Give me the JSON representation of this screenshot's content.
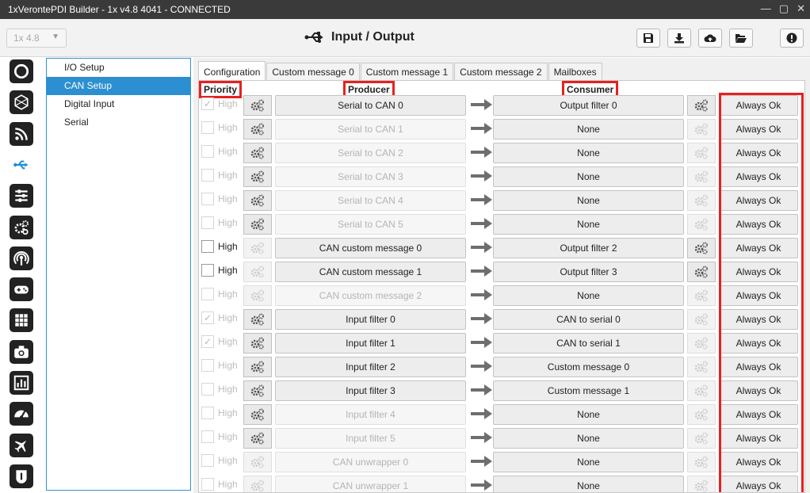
{
  "window": {
    "title": "1xVerontePDI Builder - 1x v4.8 4041 - CONNECTED",
    "controls": [
      "—",
      "▢",
      "✕"
    ]
  },
  "header": {
    "version": "1x 4.8",
    "page_title": "Input / Output",
    "buttons": [
      "save-icon",
      "download-icon",
      "cloud-upload-icon",
      "folder-open-icon",
      "info-icon"
    ]
  },
  "sidebar_icons": [
    "status-icon",
    "hex-icon",
    "rss-icon",
    "usb-icon",
    "sliders-icon",
    "gears-icon",
    "broadcast-icon",
    "gamepad-icon",
    "grid-icon",
    "camera-icon",
    "bar-chart-icon",
    "gauge-icon",
    "plane-icon",
    "shield-icon"
  ],
  "nav": {
    "items": [
      "I/O Setup",
      "CAN Setup",
      "Digital Input",
      "Serial"
    ],
    "selected": "CAN Setup"
  },
  "tabs": [
    "Configuration",
    "Custom message 0",
    "Custom message 1",
    "Custom message 2",
    "Mailboxes"
  ],
  "active_tab": "Configuration",
  "columns": {
    "priority": "Priority",
    "producer": "Producer",
    "consumer": "Consumer"
  },
  "rows": [
    {
      "checked": true,
      "priority_enabled": false,
      "high": "High",
      "prod_gear": true,
      "producer": "Serial to CAN 0",
      "producer_enabled": true,
      "consumer": "Output filter 0",
      "cons_gear": true,
      "status": "Always Ok"
    },
    {
      "checked": false,
      "priority_enabled": false,
      "high": "High",
      "prod_gear": true,
      "producer": "Serial to CAN 1",
      "producer_enabled": false,
      "consumer": "None",
      "cons_gear": false,
      "status": "Always Ok"
    },
    {
      "checked": false,
      "priority_enabled": false,
      "high": "High",
      "prod_gear": true,
      "producer": "Serial to CAN 2",
      "producer_enabled": false,
      "consumer": "None",
      "cons_gear": false,
      "status": "Always Ok"
    },
    {
      "checked": false,
      "priority_enabled": false,
      "high": "High",
      "prod_gear": true,
      "producer": "Serial to CAN 3",
      "producer_enabled": false,
      "consumer": "None",
      "cons_gear": false,
      "status": "Always Ok"
    },
    {
      "checked": false,
      "priority_enabled": false,
      "high": "High",
      "prod_gear": true,
      "producer": "Serial to CAN 4",
      "producer_enabled": false,
      "consumer": "None",
      "cons_gear": false,
      "status": "Always Ok"
    },
    {
      "checked": false,
      "priority_enabled": false,
      "high": "High",
      "prod_gear": true,
      "producer": "Serial to CAN 5",
      "producer_enabled": false,
      "consumer": "None",
      "cons_gear": false,
      "status": "Always Ok"
    },
    {
      "checked": false,
      "priority_enabled": true,
      "high": "High",
      "prod_gear": false,
      "producer": "CAN custom message 0",
      "producer_enabled": true,
      "consumer": "Output filter 2",
      "cons_gear": true,
      "status": "Always Ok"
    },
    {
      "checked": false,
      "priority_enabled": true,
      "high": "High",
      "prod_gear": false,
      "producer": "CAN custom message 1",
      "producer_enabled": true,
      "consumer": "Output filter 3",
      "cons_gear": true,
      "status": "Always Ok"
    },
    {
      "checked": false,
      "priority_enabled": false,
      "high": "High",
      "prod_gear": false,
      "producer": "CAN custom message 2",
      "producer_enabled": false,
      "consumer": "None",
      "cons_gear": false,
      "status": "Always Ok"
    },
    {
      "checked": true,
      "priority_enabled": false,
      "high": "High",
      "prod_gear": true,
      "producer": "Input filter 0",
      "producer_enabled": true,
      "consumer": "CAN to serial 0",
      "cons_gear": false,
      "status": "Always Ok"
    },
    {
      "checked": true,
      "priority_enabled": false,
      "high": "High",
      "prod_gear": true,
      "producer": "Input filter 1",
      "producer_enabled": true,
      "consumer": "CAN to serial 1",
      "cons_gear": false,
      "status": "Always Ok"
    },
    {
      "checked": false,
      "priority_enabled": false,
      "high": "High",
      "prod_gear": true,
      "producer": "Input filter 2",
      "producer_enabled": true,
      "consumer": "Custom message 0",
      "cons_gear": false,
      "status": "Always Ok"
    },
    {
      "checked": false,
      "priority_enabled": false,
      "high": "High",
      "prod_gear": true,
      "producer": "Input filter 3",
      "producer_enabled": true,
      "consumer": "Custom message 1",
      "cons_gear": false,
      "status": "Always Ok"
    },
    {
      "checked": false,
      "priority_enabled": false,
      "high": "High",
      "prod_gear": true,
      "producer": "Input filter 4",
      "producer_enabled": false,
      "consumer": "None",
      "cons_gear": false,
      "status": "Always Ok"
    },
    {
      "checked": false,
      "priority_enabled": false,
      "high": "High",
      "prod_gear": true,
      "producer": "Input filter 5",
      "producer_enabled": false,
      "consumer": "None",
      "cons_gear": false,
      "status": "Always Ok"
    },
    {
      "checked": false,
      "priority_enabled": false,
      "high": "High",
      "prod_gear": false,
      "producer": "CAN unwrapper 0",
      "producer_enabled": false,
      "consumer": "None",
      "cons_gear": false,
      "status": "Always Ok"
    },
    {
      "checked": false,
      "priority_enabled": false,
      "high": "High",
      "prod_gear": false,
      "producer": "CAN unwrapper 1",
      "producer_enabled": false,
      "consumer": "None",
      "cons_gear": false,
      "status": "Always Ok"
    }
  ],
  "colors": {
    "accent": "#2c8fd1",
    "highlight": "#e8201f",
    "titlebar": "#3a3a3a"
  }
}
